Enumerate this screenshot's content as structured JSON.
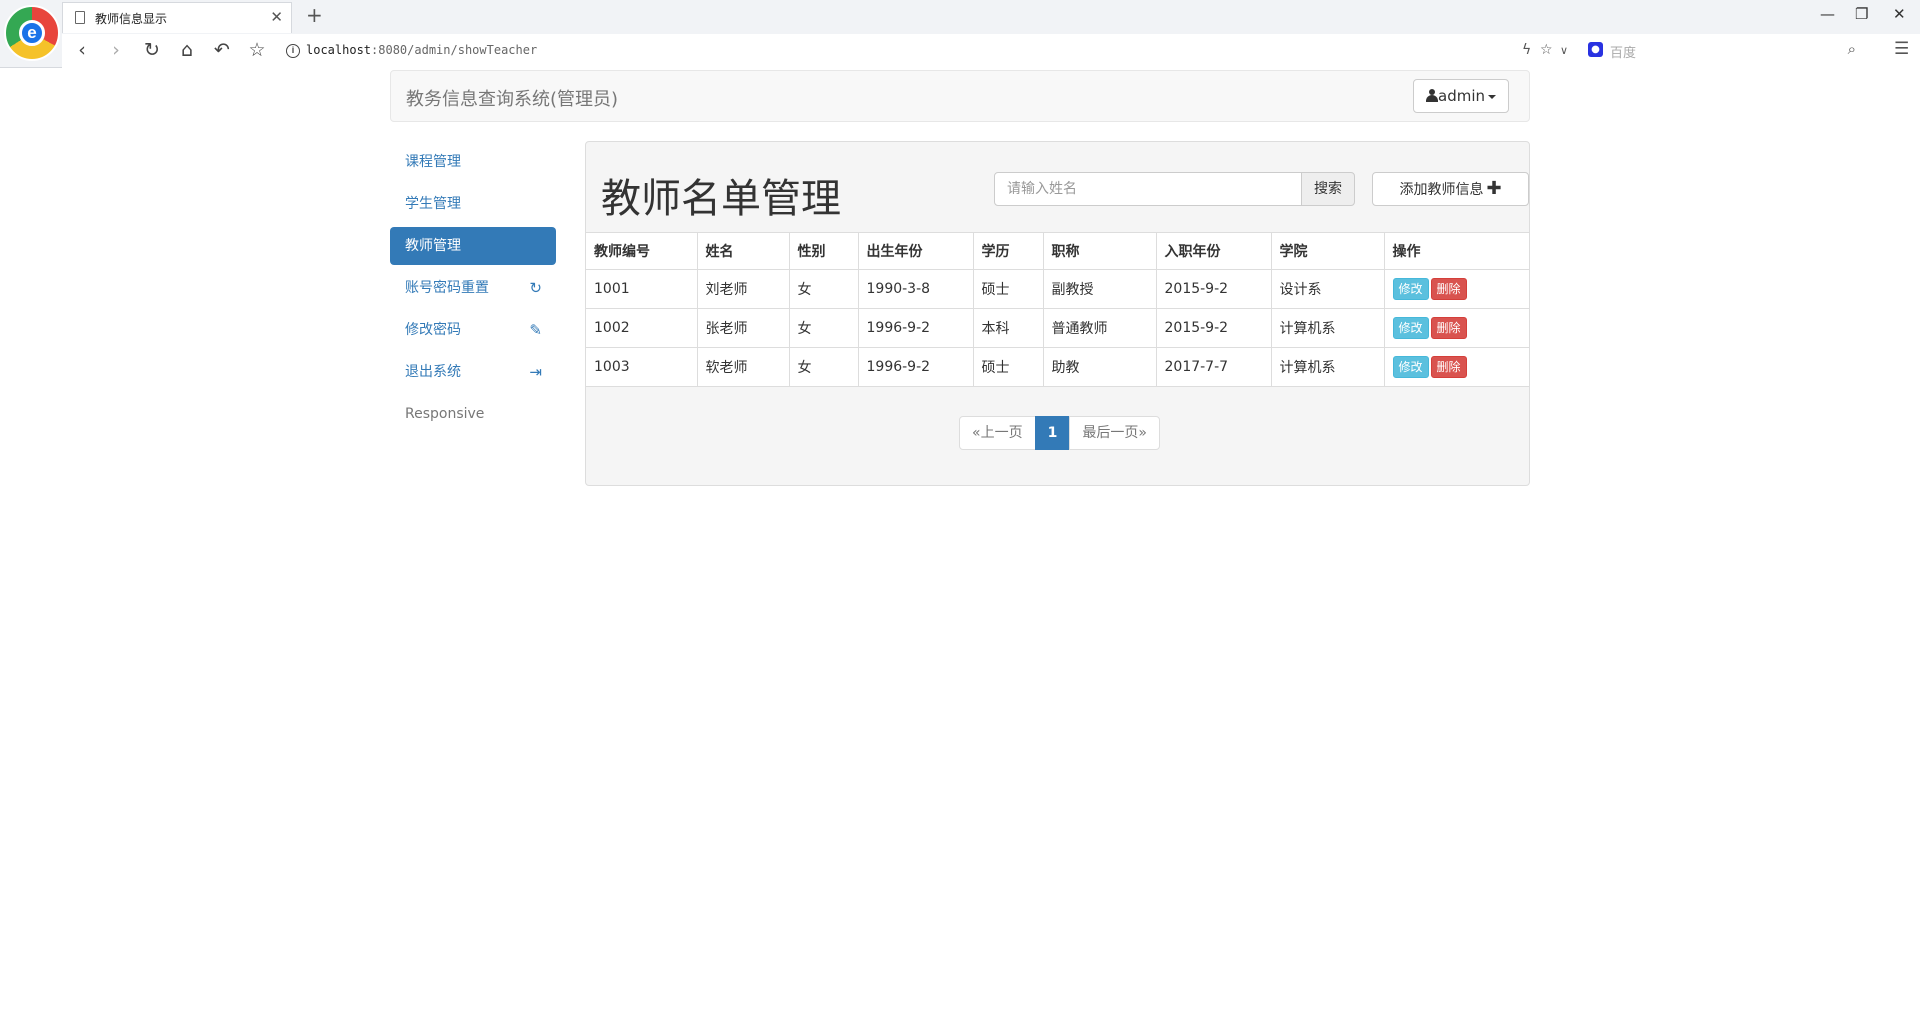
{
  "browser": {
    "tab_title": "教师信息显示",
    "url_host": "localhost",
    "url_port_path": ":8080/admin/showTeacher",
    "search_placeholder": "百度"
  },
  "navbar": {
    "brand": "教务信息查询系统(管理员)",
    "user": "admin"
  },
  "sidebar": {
    "items": [
      {
        "label": "课程管理",
        "icon": ""
      },
      {
        "label": "学生管理",
        "icon": ""
      },
      {
        "label": "教师管理",
        "icon": "",
        "active": true
      },
      {
        "label": "账号密码重置",
        "icon": "refresh-icon"
      },
      {
        "label": "修改密码",
        "icon": "pencil-icon"
      },
      {
        "label": "退出系统",
        "icon": "logout-icon"
      },
      {
        "label": "Responsive",
        "icon": ""
      }
    ]
  },
  "main": {
    "title": "教师名单管理",
    "search_placeholder": "请输入姓名",
    "search_button": "搜索",
    "add_button": "添加教师信息"
  },
  "table": {
    "headers": [
      "教师编号",
      "姓名",
      "性别",
      "出生年份",
      "学历",
      "职称",
      "入职年份",
      "学院",
      "操作"
    ],
    "rows": [
      [
        "1001",
        "刘老师",
        "女",
        "1990-3-8",
        "硕士",
        "副教授",
        "2015-9-2",
        "设计系"
      ],
      [
        "1002",
        "张老师",
        "女",
        "1996-9-2",
        "本科",
        "普通教师",
        "2015-9-2",
        "计算机系"
      ],
      [
        "1003",
        "软老师",
        "女",
        "1996-9-2",
        "硕士",
        "助教",
        "2017-7-7",
        "计算机系"
      ]
    ],
    "edit_label": "修改",
    "delete_label": "删除"
  },
  "pagination": {
    "prev": "«上一页",
    "current": "1",
    "last": "最后一页»"
  },
  "colors": {
    "primary": "#337ab7",
    "info": "#5bc0de",
    "danger": "#d9534f"
  }
}
